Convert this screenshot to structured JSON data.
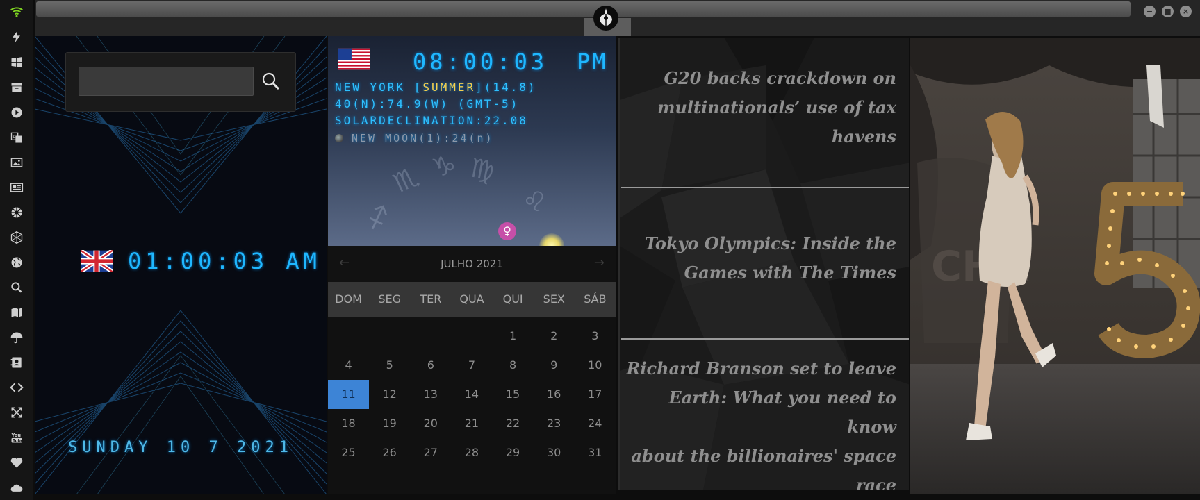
{
  "app": {
    "window_buttons": [
      "minimize",
      "maximize",
      "close"
    ]
  },
  "sidebar": {
    "icons": [
      "wifi-icon",
      "lightning-icon",
      "windows-icon",
      "archive-icon",
      "play-icon",
      "translate-icon",
      "image-icon",
      "newspaper-icon",
      "empire-icon",
      "hexagon-icon",
      "globe-icon",
      "search-icon",
      "map-icon",
      "umbrella-icon",
      "contacts-icon",
      "code-icon",
      "expand-icon",
      "youtube-icon",
      "heart-icon",
      "cloud-icon"
    ],
    "wifi_color": "#7ed321"
  },
  "search": {
    "placeholder": ""
  },
  "uk_clock": {
    "time": "01:00:03  AM",
    "date": "SUNDAY 10 7 2021"
  },
  "ny_clock": {
    "time": "08:00:03",
    "ampm": "PM",
    "line1_pre": "NEW YORK [",
    "line1_hl": "SUMMER",
    "line1_post": "](14.8)",
    "line2": "40(N):74.9(W) (GMT-5)",
    "line3": "SOLARDECLINATION:22.08",
    "moon": "NEW MOON(1):24(n)"
  },
  "calendar": {
    "prev": "←",
    "next": "→",
    "month": "JULHO 2021",
    "weekdays": [
      "DOM",
      "SEG",
      "TER",
      "QUA",
      "QUI",
      "SEX",
      "SÁB"
    ],
    "today": "11",
    "accent": "#3d84d6",
    "weeks": [
      [
        "",
        "",
        "",
        "",
        "1",
        "2",
        "3"
      ],
      [
        "4",
        "5",
        "6",
        "7",
        "8",
        "9",
        "10"
      ],
      [
        "11",
        "12",
        "13",
        "14",
        "15",
        "16",
        "17"
      ],
      [
        "18",
        "19",
        "20",
        "21",
        "22",
        "23",
        "24"
      ],
      [
        "25",
        "26",
        "27",
        "28",
        "29",
        "30",
        "31"
      ]
    ]
  },
  "news": [
    [
      "G20 backs crackdown on",
      "multinationals’ use of tax",
      "havens"
    ],
    [
      "Tokyo Olympics: Inside the",
      "Games with The Times"
    ],
    [
      "Richard Branson set to leave",
      "Earth: What you need to know",
      "about the billionaires' space",
      "race"
    ]
  ]
}
